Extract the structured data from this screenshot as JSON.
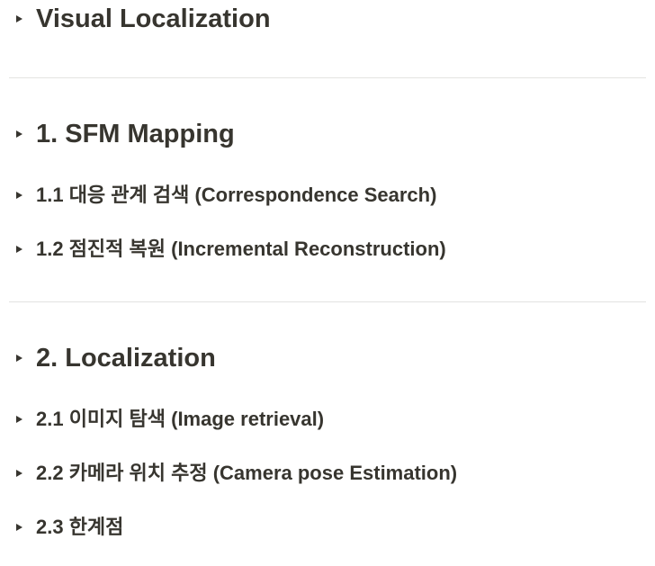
{
  "sections": [
    {
      "heading": "Visual Localization",
      "items": []
    },
    {
      "heading": "1. SFM Mapping",
      "items": [
        "1.1 대응 관계 검색 (Correspondence Search)",
        "1.2 점진적 복원 (Incremental Reconstruction)"
      ]
    },
    {
      "heading": "2. Localization",
      "items": [
        "2.1 이미지 탐색 (Image retrieval)",
        "2.2 카메라 위치 추정 (Camera pose Estimation)",
        "2.3 한계점"
      ]
    }
  ]
}
